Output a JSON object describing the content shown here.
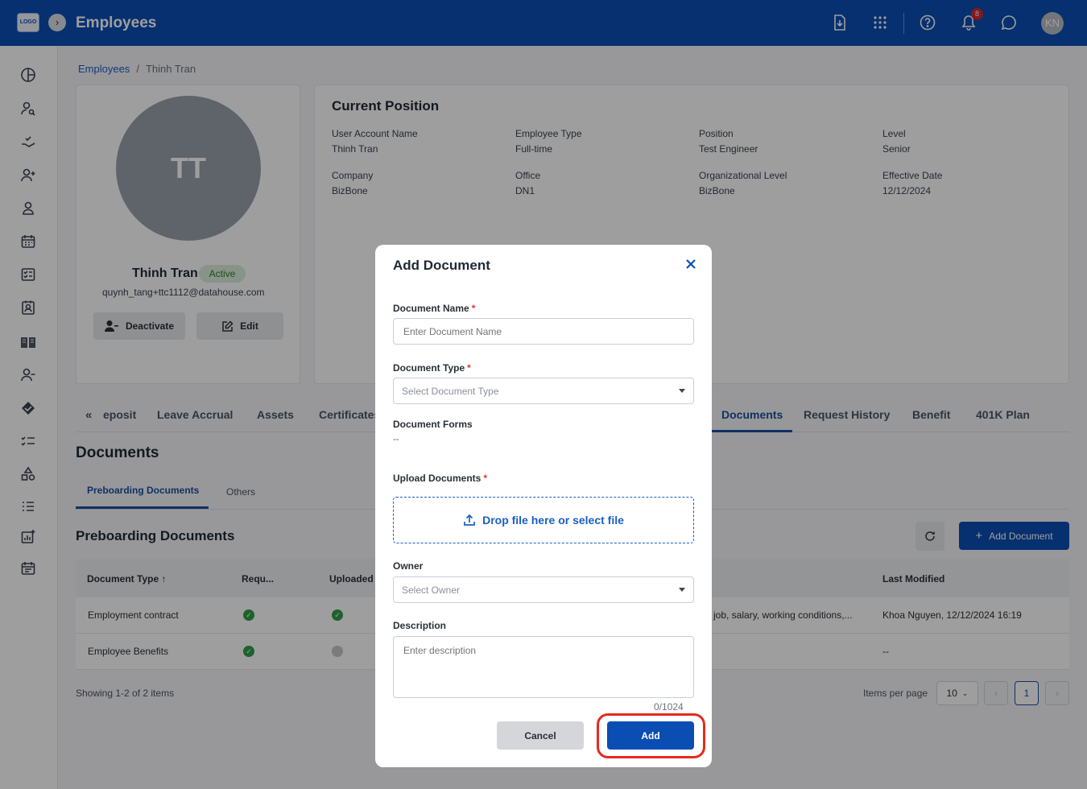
{
  "header": {
    "logo": "LOGO",
    "title": "Employees",
    "notification_count": "8",
    "user_initials": "KN"
  },
  "breadcrumb": {
    "parent": "Employees",
    "separator": "/",
    "current": "Thinh Tran"
  },
  "profile": {
    "initials": "TT",
    "name": "Thinh Tran",
    "status": "Active",
    "email": "quynh_tang+ttc1112@datahouse.com",
    "deactivate_label": "Deactivate",
    "edit_label": "Edit"
  },
  "position": {
    "title": "Current Position",
    "fields": [
      {
        "label": "User Account Name",
        "value": "Thinh Tran"
      },
      {
        "label": "Employee Type",
        "value": "Full-time"
      },
      {
        "label": "Position",
        "value": "Test Engineer"
      },
      {
        "label": "Level",
        "value": "Senior"
      },
      {
        "label": "Company",
        "value": "BizBone"
      },
      {
        "label": "Office",
        "value": "DN1"
      },
      {
        "label": "Organizational Level",
        "value": "BizBone"
      },
      {
        "label": "Effective Date",
        "value": "12/12/2024"
      }
    ]
  },
  "tabs": {
    "scroll_left": "«",
    "items": [
      "eposit",
      "Leave Accrual",
      "Assets",
      "Certificates",
      "Documents",
      "Request History",
      "Benefit",
      "401K Plan"
    ],
    "active": "Documents"
  },
  "documents": {
    "title": "Documents",
    "sub_tabs": [
      "Preboarding Documents",
      "Others"
    ],
    "section_title": "Preboarding Documents",
    "add_button": "Add Document",
    "columns": [
      "Document Type",
      "Requ...",
      "Uploaded",
      "Last Modified"
    ],
    "rows": [
      {
        "type": "Employment contract",
        "description": "job, salary, working conditions,...",
        "last_modified": "Khoa Nguyen, 12/12/2024 16:19"
      },
      {
        "type": "Employee Benefits",
        "description": "",
        "last_modified": "--"
      }
    ],
    "showing": "Showing 1-2 of 2 items",
    "items_per_page_label": "Items per page",
    "items_per_page": "10",
    "current_page": "1"
  },
  "modal": {
    "title": "Add Document",
    "doc_name_label": "Document Name",
    "doc_name_placeholder": "Enter Document Name",
    "doc_type_label": "Document Type",
    "doc_type_placeholder": "Select Document Type",
    "doc_forms_label": "Document Forms",
    "doc_forms_value": "--",
    "upload_label": "Upload Documents",
    "dropzone_text": "Drop file here or select file",
    "owner_label": "Owner",
    "owner_placeholder": "Select Owner",
    "description_label": "Description",
    "description_placeholder": "Enter description",
    "char_count": "0/1024",
    "cancel_label": "Cancel",
    "add_label": "Add",
    "required_mark": "*"
  },
  "colors": {
    "brand": "#0b4eb3",
    "highlight": "#e52a20",
    "success": "#2e9e47"
  }
}
